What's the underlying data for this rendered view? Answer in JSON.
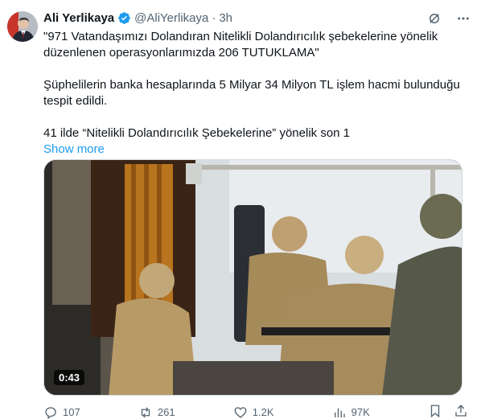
{
  "author": {
    "name": "Ali Yerlikaya",
    "handle": "@AliYerlikaya",
    "separator": "·",
    "time": "3h",
    "verified_color": "#1d9bf0"
  },
  "tweet": {
    "paragraph1": "\"971 Vatandaşımızı Dolandıran Nitelikli Dolandırıcılık şebekelerine yönelik düzenlenen operasyonlarımızda 206 TUTUKLAMA\"",
    "paragraph2": "Şüphelilerin banka hesaplarında 5 Milyar 34 Milyon TL işlem hacmi bulunduğu tespit edildi.",
    "paragraph3": "41 ilde “Nitelikli Dolandırıcılık Şebekelerine” yönelik son 1",
    "show_more": "Show more"
  },
  "media": {
    "type": "video",
    "duration": "0:43"
  },
  "actions": {
    "replies": "107",
    "reposts": "261",
    "likes": "1.2K",
    "views": "97K"
  },
  "colors": {
    "accent": "#1d9bf0",
    "secondary_text": "#536471",
    "primary_text": "#0f1419"
  },
  "icons": [
    "verified-badge-icon",
    "grok-icon",
    "more-icon",
    "reply-icon",
    "repost-icon",
    "like-icon",
    "views-icon",
    "bookmark-icon",
    "share-icon"
  ]
}
